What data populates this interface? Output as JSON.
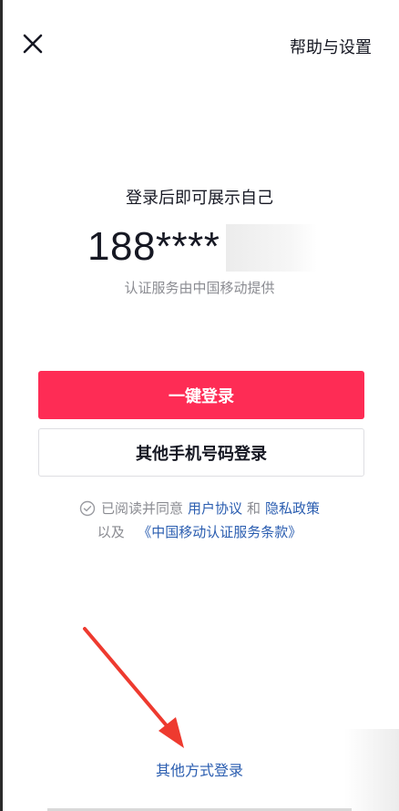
{
  "header": {
    "close_icon": "close-icon",
    "help_label": "帮助与设置"
  },
  "login": {
    "title": "登录后即可展示自己",
    "phone_masked": "188****",
    "auth_note": "认证服务由中国移动提供",
    "one_click_label": "一键登录",
    "other_phone_label": "其他手机号码登录"
  },
  "agreement": {
    "check_icon": "circle-check-icon",
    "prefix": "已阅读并同意",
    "user_agreement": "用户协议",
    "and": "和",
    "privacy_policy": "隐私政策",
    "also": "以及",
    "cmcc_terms": "《中国移动认证服务条款》"
  },
  "footer": {
    "other_login_label": "其他方式登录"
  },
  "colors": {
    "primary": "#fe2c55",
    "link": "#2a5db0",
    "annotation_arrow": "#ee3a2f"
  }
}
